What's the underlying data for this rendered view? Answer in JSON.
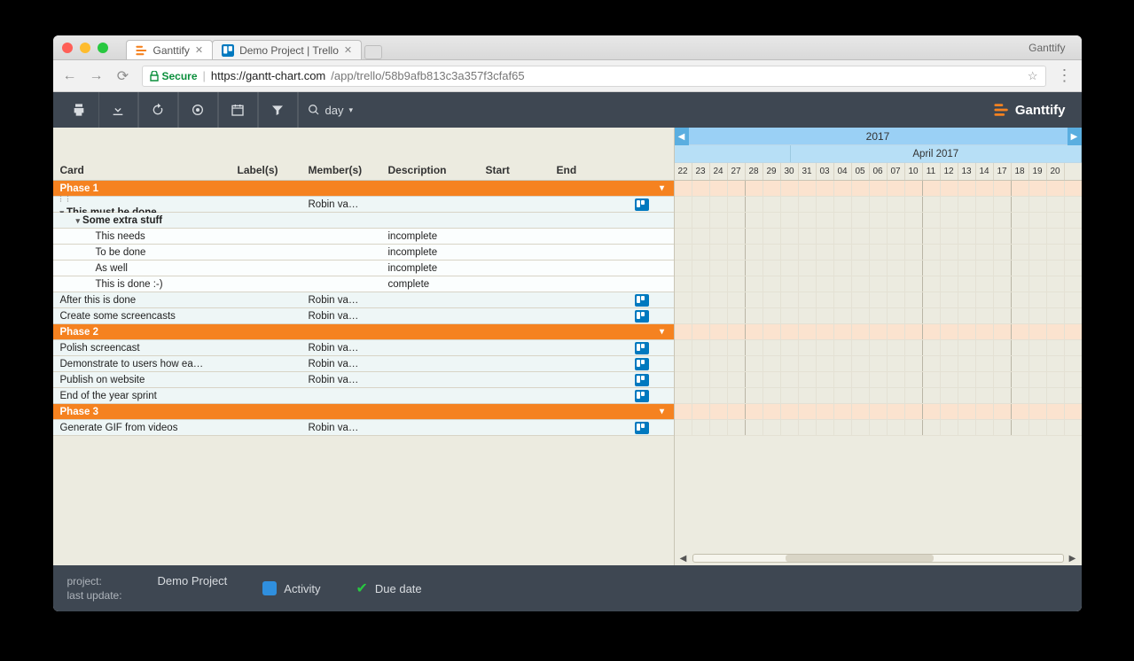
{
  "browser": {
    "tabs": [
      {
        "title": "Ganttify",
        "active": true,
        "icon": "ganttify"
      },
      {
        "title": "Demo Project | Trello",
        "active": false,
        "icon": "trello"
      }
    ],
    "window_app": "Ganttify",
    "secure_label": "Secure",
    "url_host": "https://gantt-chart.com",
    "url_path": "/app/trello/58b9afb813c3a357f3cfaf65"
  },
  "toolbar": {
    "zoom_label": "day"
  },
  "brand": "Ganttify",
  "grid": {
    "headers": {
      "card": "Card",
      "label": "Label(s)",
      "member": "Member(s)",
      "description": "Description",
      "start": "Start",
      "end": "End"
    },
    "rows": [
      {
        "type": "phase",
        "card": "Phase 1"
      },
      {
        "type": "task",
        "bold": true,
        "card": "This must be done",
        "member": "Robin va…",
        "badge": true,
        "handle": true,
        "toggle": true
      },
      {
        "type": "task",
        "bold": true,
        "indent": 1,
        "card": "Some extra stuff",
        "toggle": true
      },
      {
        "type": "task",
        "sub": true,
        "indent": 2,
        "card": "This needs",
        "description": "incomplete"
      },
      {
        "type": "task",
        "sub": true,
        "indent": 2,
        "card": "To be done",
        "description": "incomplete"
      },
      {
        "type": "task",
        "sub": true,
        "indent": 2,
        "card": "As well",
        "description": "incomplete"
      },
      {
        "type": "task",
        "sub": true,
        "indent": 2,
        "card": "This is done :-)",
        "description": "complete"
      },
      {
        "type": "task",
        "card": "After this is done",
        "member": "Robin va…",
        "badge": true
      },
      {
        "type": "task",
        "card": "Create some screencasts",
        "member": "Robin va…",
        "badge": true
      },
      {
        "type": "phase",
        "card": "Phase 2"
      },
      {
        "type": "task",
        "card": "Polish screencast",
        "member": "Robin va…",
        "badge": true
      },
      {
        "type": "task",
        "card": "Demonstrate to users how ea…",
        "member": "Robin va…",
        "badge": true
      },
      {
        "type": "task",
        "card": "Publish on website",
        "member": "Robin va…",
        "badge": true
      },
      {
        "type": "task",
        "card": "End of the year sprint",
        "badge": true
      },
      {
        "type": "phase",
        "card": "Phase 3"
      },
      {
        "type": "task",
        "card": "Generate GIF from videos",
        "member": "Robin va…",
        "badge": true
      }
    ]
  },
  "timeline": {
    "year": "2017",
    "months": [
      "",
      "April 2017"
    ],
    "days": [
      "22",
      "23",
      "24",
      "27",
      "28",
      "29",
      "30",
      "31",
      "03",
      "04",
      "05",
      "06",
      "07",
      "10",
      "11",
      "12",
      "13",
      "14",
      "17",
      "18",
      "19",
      "20"
    ]
  },
  "footer": {
    "project_label": "project:",
    "project_value": "Demo Project",
    "lastupdate_label": "last update:",
    "activity": "Activity",
    "duedate": "Due date",
    "activity_color": "#2f8fde"
  }
}
